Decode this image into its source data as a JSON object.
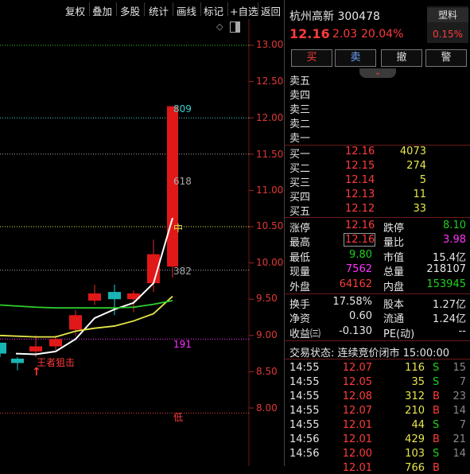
{
  "toolbar": {
    "items": [
      "复权",
      "叠加",
      "多股",
      "统计",
      "画线",
      "标记",
      "+自选",
      "返回"
    ]
  },
  "chart": {
    "y_ticks": [
      "13.00",
      "12.50",
      "12.00",
      "11.50",
      "11.00",
      "10.50",
      "10.00",
      "9.50",
      "9.00",
      "8.50",
      "8.00"
    ],
    "ref_lines": [
      {
        "label": "",
        "color": "#2fd12f"
      },
      {
        "label": "809",
        "color": "#3ad0d0"
      },
      {
        "label": "618",
        "color": "#aaaaaa"
      },
      {
        "label": "中",
        "color": "#e7e74a"
      },
      {
        "label": "382",
        "color": "#aaaaaa"
      },
      {
        "label": "191",
        "color": "#ff33ff"
      },
      {
        "label": "低",
        "color": "#ff3b3b"
      }
    ],
    "annotation": "王者狙击",
    "icons": [
      "diamond-icon",
      "window-icon",
      "up-arrow-icon"
    ]
  },
  "stock": {
    "name": "杭州高新 300478",
    "sector_button": "塑料",
    "sector_change": "0.15%",
    "price": "12.16",
    "change": "2.03",
    "change_pct": "20.04%"
  },
  "actions": [
    "买",
    "卖",
    "撤",
    "警"
  ],
  "sell_levels": [
    {
      "label": "卖五",
      "price": "",
      "volume": ""
    },
    {
      "label": "卖四",
      "price": "",
      "volume": ""
    },
    {
      "label": "卖三",
      "price": "",
      "volume": ""
    },
    {
      "label": "卖二",
      "price": "",
      "volume": ""
    },
    {
      "label": "卖一",
      "price": "",
      "volume": ""
    }
  ],
  "buy_levels": [
    {
      "label": "买一",
      "price": "12.16",
      "volume": "4073"
    },
    {
      "label": "买二",
      "price": "12.15",
      "volume": "274"
    },
    {
      "label": "买三",
      "price": "12.14",
      "volume": "5"
    },
    {
      "label": "买四",
      "price": "12.13",
      "volume": "11"
    },
    {
      "label": "买五",
      "price": "12.12",
      "volume": "33"
    }
  ],
  "quote": {
    "limit_up_label": "涨停",
    "limit_up": "12.16",
    "limit_down_label": "跌停",
    "limit_down": "8.10",
    "high_label": "最高",
    "high": "12.16",
    "vol_ratio_label": "量比",
    "vol_ratio": "3.98",
    "low_label": "最低",
    "low": "9.80",
    "mkt_cap_label": "市值",
    "mkt_cap": "15.4亿",
    "cur_vol_label": "现量",
    "cur_vol": "7562",
    "total_vol_label": "总量",
    "total_vol": "218107",
    "outer_label": "外盘",
    "outer": "64162",
    "inner_label": "内盘",
    "inner": "153945"
  },
  "fundamentals": {
    "turnover_label": "换手",
    "turnover": "17.58%",
    "shares_label": "股本",
    "shares": "1.27亿",
    "nav_label": "净资",
    "nav": "0.60",
    "float_label": "流通",
    "float": "1.24亿",
    "eps_label": "收益㈢",
    "eps": "-0.130",
    "pe_label": "PE(动)",
    "pe": "--"
  },
  "trade_status": "交易状态: 连续竞价闭市 15:00:00",
  "trades": [
    {
      "time": "14:55",
      "price": "12.07",
      "vol": "116",
      "side": "S",
      "count": "15"
    },
    {
      "time": "14:55",
      "price": "12.05",
      "vol": "35",
      "side": "S",
      "count": "7"
    },
    {
      "time": "14:55",
      "price": "12.08",
      "vol": "312",
      "side": "B",
      "count": "23"
    },
    {
      "time": "14:55",
      "price": "12.07",
      "vol": "210",
      "side": "B",
      "count": "14"
    },
    {
      "time": "14:55",
      "price": "12.01",
      "vol": "44",
      "side": "S",
      "count": "7"
    },
    {
      "time": "14:56",
      "price": "12.01",
      "vol": "429",
      "side": "B",
      "count": "21"
    },
    {
      "time": "14:56",
      "price": "12.00",
      "vol": "103",
      "side": "S",
      "count": "14"
    },
    {
      "time": "",
      "price": "12.01",
      "vol": "766",
      "side": "B",
      "count": ""
    }
  ],
  "colors": {
    "up": "#ff3b3b",
    "down": "#1fd11f",
    "yellow": "#e7e74a",
    "cyan": "#3ad0d0",
    "magenta": "#ff33ff"
  },
  "chart_data": {
    "type": "candlestick",
    "ylim": [
      7.75,
      13.15
    ],
    "y_ticks": [
      13.0,
      12.5,
      12.0,
      11.5,
      11.0,
      10.5,
      10.0,
      9.5,
      9.0,
      8.5,
      8.0
    ],
    "ref_levels": [
      13.0,
      12.0,
      11.5,
      10.5,
      9.9,
      8.95,
      7.93
    ],
    "candles": [
      {
        "open": 8.9,
        "close": 8.75,
        "high": 8.9,
        "low": 8.7
      },
      {
        "open": 8.68,
        "close": 8.62,
        "high": 8.7,
        "low": 8.52
      },
      {
        "open": 8.78,
        "close": 8.85,
        "high": 9.0,
        "low": 8.7
      },
      {
        "open": 8.85,
        "close": 8.95,
        "high": 9.0,
        "low": 8.8
      },
      {
        "open": 9.08,
        "close": 9.28,
        "high": 9.35,
        "low": 9.0
      },
      {
        "open": 9.48,
        "close": 9.58,
        "high": 9.7,
        "low": 9.42
      },
      {
        "open": 9.6,
        "close": 9.5,
        "high": 9.7,
        "low": 9.28
      },
      {
        "open": 9.5,
        "close": 9.58,
        "high": 9.62,
        "low": 9.32
      },
      {
        "open": 9.72,
        "close": 10.12,
        "high": 10.32,
        "low": 9.6
      },
      {
        "open": 9.95,
        "close": 12.16,
        "high": 12.16,
        "low": 9.8
      }
    ],
    "series": [
      {
        "color": "#ffffff",
        "values": [
          8.75,
          8.74,
          8.78,
          8.95,
          9.24,
          9.36,
          9.45,
          9.72,
          10.62
        ]
      },
      {
        "color": "#e7e74a",
        "values": [
          9.0,
          8.98,
          8.98,
          9.06,
          9.1,
          9.13,
          9.2,
          9.3,
          9.54
        ]
      },
      {
        "color": "#2fd12f",
        "values": [
          9.42,
          9.39,
          9.38,
          9.38,
          9.38,
          9.38,
          9.39,
          9.43,
          9.48
        ]
      }
    ]
  }
}
